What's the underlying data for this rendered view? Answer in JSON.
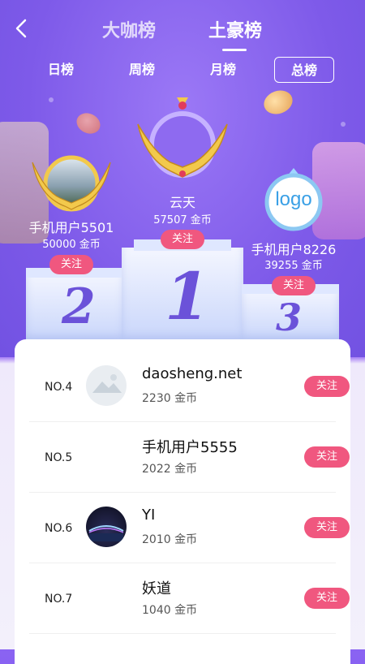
{
  "header": {
    "tabs": [
      {
        "label": "大咖榜",
        "active": false
      },
      {
        "label": "土豪榜",
        "active": true
      }
    ]
  },
  "periods": [
    {
      "label": "日榜",
      "active": false
    },
    {
      "label": "周榜",
      "active": false
    },
    {
      "label": "月榜",
      "active": false
    },
    {
      "label": "总榜",
      "active": true
    }
  ],
  "podium": {
    "first": {
      "name": "云天",
      "coins": "57507 金币",
      "follow": "关注",
      "place": "1"
    },
    "second": {
      "name": "手机用户5501",
      "coins": "50000 金币",
      "follow": "关注",
      "place": "2"
    },
    "third": {
      "name": "手机用户8226",
      "coins": "39255 金币",
      "follow": "关注",
      "place": "3",
      "avatar_text": "logo"
    }
  },
  "list": [
    {
      "rank": "NO.4",
      "name": "daosheng.net",
      "coins": "2230 金币",
      "follow": "关注"
    },
    {
      "rank": "NO.5",
      "name": "手机用户5555",
      "coins": "2022 金币",
      "follow": "关注"
    },
    {
      "rank": "NO.6",
      "name": "YI",
      "coins": "2010 金币",
      "follow": "关注"
    },
    {
      "rank": "NO.7",
      "name": "妖道",
      "coins": "1040 金币",
      "follow": "关注"
    }
  ],
  "colors": {
    "accent": "#f0577f",
    "primary": "#7b57ee",
    "rank_num": "#6b52d9"
  }
}
